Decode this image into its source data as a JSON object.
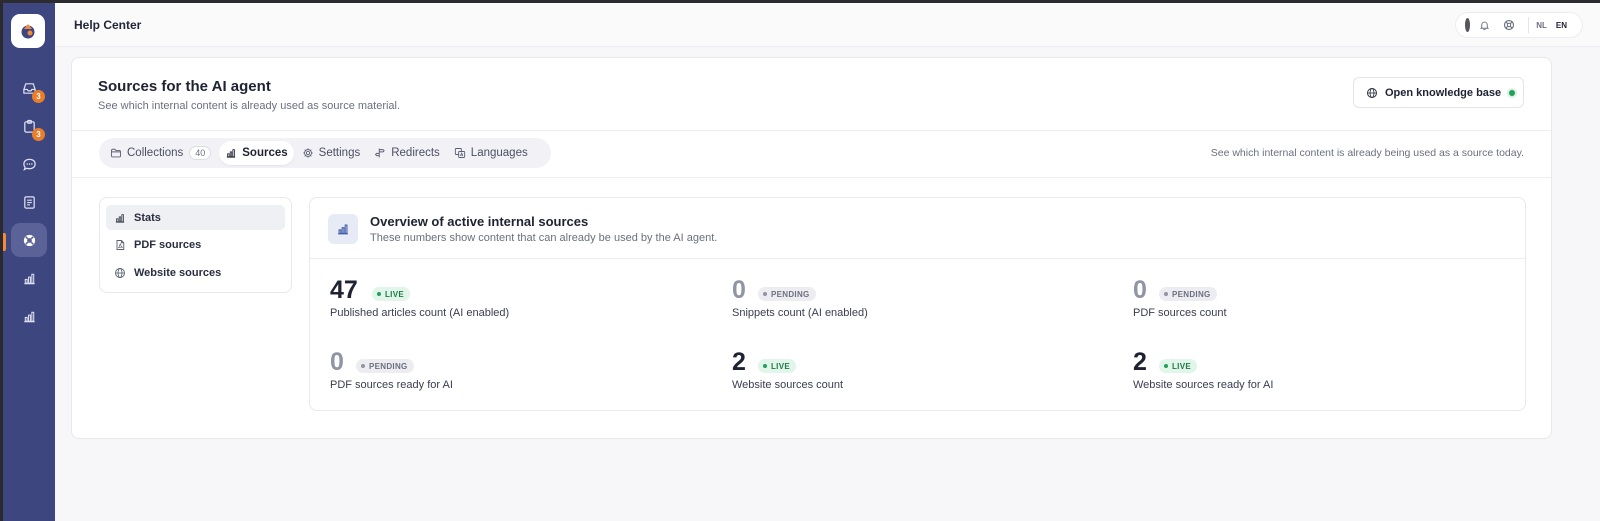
{
  "header": {
    "title": "Help Center"
  },
  "sidebar": {
    "logo": "app-logo",
    "items": [
      {
        "name": "inbox",
        "icon": "inbox-icon",
        "badge": "3"
      },
      {
        "name": "tasks",
        "icon": "clipboard-icon",
        "badge": "3"
      },
      {
        "name": "chat",
        "icon": "chat-icon"
      },
      {
        "name": "articles",
        "icon": "document-icon"
      },
      {
        "name": "help-center",
        "icon": "lifebuoy-icon",
        "active": true
      },
      {
        "name": "reports",
        "icon": "bar-chart-icon"
      },
      {
        "name": "analytics",
        "icon": "bar-chart-icon"
      }
    ]
  },
  "topbar": {
    "languages": [
      "NL",
      "EN"
    ],
    "selected_language": "EN"
  },
  "page": {
    "title": "Sources for the AI agent",
    "subtitle": "See which internal content is already used as source material.",
    "open_kb_label": "Open knowledge base",
    "status_color": "#22a05a"
  },
  "tabs": {
    "items": [
      {
        "label": "Collections",
        "icon": "folder-icon",
        "count": "40"
      },
      {
        "label": "Sources",
        "icon": "bar-chart-icon",
        "active": true
      },
      {
        "label": "Settings",
        "icon": "gear-icon"
      },
      {
        "label": "Redirects",
        "icon": "signpost-icon"
      },
      {
        "label": "Languages",
        "icon": "translate-icon"
      }
    ],
    "hint": "See which internal content is already being used as a source today."
  },
  "subnav": {
    "items": [
      {
        "label": "Stats",
        "icon": "bar-chart-icon",
        "active": true
      },
      {
        "label": "PDF sources",
        "icon": "pdf-file-icon"
      },
      {
        "label": "Website sources",
        "icon": "globe-icon"
      }
    ]
  },
  "overview": {
    "title": "Overview of active internal sources",
    "subtitle": "These numbers show content that can already be used by the AI agent.",
    "stats": [
      {
        "value": "47",
        "status": "LIVE",
        "label": "Published articles count (AI enabled)"
      },
      {
        "value": "0",
        "status": "PENDING",
        "label": "Snippets count (AI enabled)"
      },
      {
        "value": "0",
        "status": "PENDING",
        "label": "PDF sources count"
      },
      {
        "value": "0",
        "status": "PENDING",
        "label": "PDF sources ready for AI"
      },
      {
        "value": "2",
        "status": "LIVE",
        "label": "Website sources count"
      },
      {
        "value": "2",
        "status": "LIVE",
        "label": "Website sources ready for AI"
      }
    ]
  },
  "colors": {
    "sidebar": "#3e4680",
    "accent": "#ea7d2a",
    "live": "#22a05a"
  }
}
